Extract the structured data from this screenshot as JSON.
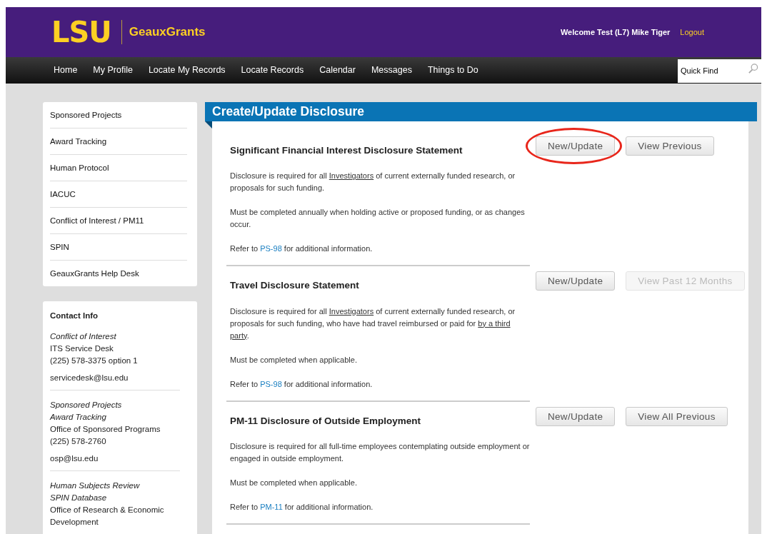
{
  "header": {
    "logo": "LSU",
    "app_name": "GeauxGrants",
    "welcome": "Welcome Test (L7) Mike Tiger",
    "logout": "Logout"
  },
  "nav": {
    "items": [
      {
        "label": "Home"
      },
      {
        "label": "My Profile"
      },
      {
        "label": "Locate My Records"
      },
      {
        "label": "Locate Records"
      },
      {
        "label": "Calendar"
      },
      {
        "label": "Messages"
      },
      {
        "label": "Things to Do"
      }
    ],
    "quick_find": {
      "placeholder": "Quick Find"
    }
  },
  "sidebar": {
    "items": [
      {
        "label": "Sponsored Projects"
      },
      {
        "label": "Award Tracking"
      },
      {
        "label": "Human Protocol"
      },
      {
        "label": "IACUC"
      },
      {
        "label": "Conflict of Interest / PM11"
      },
      {
        "label": "SPIN"
      },
      {
        "label": "GeauxGrants Help Desk"
      }
    ],
    "contact": {
      "title": "Contact Info",
      "groups": [
        {
          "lines": [
            {
              "text": "Conflict of Interest",
              "kind": "topic"
            },
            {
              "text": "ITS Service Desk",
              "kind": "plain"
            },
            {
              "text": "(225) 578-3375 option 1",
              "kind": "plain"
            },
            {
              "text": "servicedesk@lsu.edu",
              "kind": "email"
            }
          ]
        },
        {
          "lines": [
            {
              "text": "Sponsored Projects",
              "kind": "topic"
            },
            {
              "text": "Award Tracking",
              "kind": "topic"
            },
            {
              "text": "Office of Sponsored Programs",
              "kind": "plain"
            },
            {
              "text": "(225) 578-2760",
              "kind": "plain"
            },
            {
              "text": "osp@lsu.edu",
              "kind": "email"
            }
          ]
        },
        {
          "lines": [
            {
              "text": "Human Subjects Review",
              "kind": "topic"
            },
            {
              "text": "SPIN Database",
              "kind": "topic"
            },
            {
              "text": "Office of Research & Economic Development",
              "kind": "plain"
            }
          ]
        }
      ]
    }
  },
  "panel": {
    "title": "Create/Update Disclosure",
    "sections": [
      {
        "title": "Significant Financial Interest Disclosure Statement",
        "paragraphs": [
          [
            {
              "text": "Disclosure is required for all ",
              "kind": "plain"
            },
            {
              "text": "Investigators",
              "kind": "term"
            },
            {
              "text": " of current externally funded research, or proposals for such funding.",
              "kind": "plain"
            }
          ],
          [
            {
              "text": "Must be completed annually when holding active or proposed funding, or as changes occur.",
              "kind": "plain"
            }
          ],
          [
            {
              "text": "Refer to ",
              "kind": "plain"
            },
            {
              "text": "PS-98",
              "kind": "link"
            },
            {
              "text": " for additional information.",
              "kind": "plain"
            }
          ]
        ],
        "buttons": [
          {
            "label": "New/Update",
            "disabled": false,
            "highlighted": true
          },
          {
            "label": "View Previous",
            "disabled": false,
            "highlighted": false
          }
        ]
      },
      {
        "title": "Travel Disclosure Statement",
        "paragraphs": [
          [
            {
              "text": "Disclosure is required for all ",
              "kind": "plain"
            },
            {
              "text": "Investigators",
              "kind": "term"
            },
            {
              "text": " of current externally funded research, or proposals for such funding, who have had travel reimbursed or paid for ",
              "kind": "plain"
            },
            {
              "text": "by a third party",
              "kind": "term"
            },
            {
              "text": ".",
              "kind": "plain"
            }
          ],
          [
            {
              "text": "Must be completed when applicable.",
              "kind": "plain"
            }
          ],
          [
            {
              "text": "Refer to ",
              "kind": "plain"
            },
            {
              "text": "PS-98",
              "kind": "link"
            },
            {
              "text": " for additional information.",
              "kind": "plain"
            }
          ]
        ],
        "buttons": [
          {
            "label": "New/Update",
            "disabled": false,
            "highlighted": false
          },
          {
            "label": "View Past 12 Months",
            "disabled": true,
            "highlighted": false
          }
        ]
      },
      {
        "title": "PM-11 Disclosure of Outside Employment",
        "paragraphs": [
          [
            {
              "text": "Disclosure is required for all full-time employees contemplating outside employment or engaged in outside employment.",
              "kind": "plain"
            }
          ],
          [
            {
              "text": "Must be completed when applicable.",
              "kind": "plain"
            }
          ],
          [
            {
              "text": "Refer to ",
              "kind": "plain"
            },
            {
              "text": "PM-11",
              "kind": "link"
            },
            {
              "text": " for additional information.",
              "kind": "plain"
            }
          ]
        ],
        "buttons": [
          {
            "label": "New/Update",
            "disabled": false,
            "highlighted": false
          },
          {
            "label": "View All Previous",
            "disabled": false,
            "highlighted": false
          }
        ]
      }
    ]
  }
}
